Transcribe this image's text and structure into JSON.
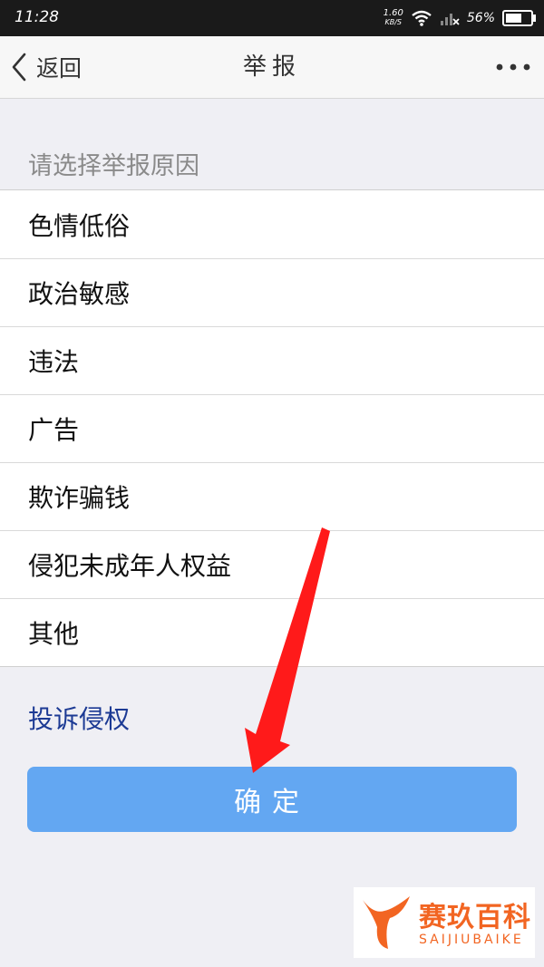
{
  "status_bar": {
    "time": "11:28",
    "net_speed": "1.60",
    "net_unit": "KB/S",
    "battery": "56%"
  },
  "nav": {
    "back_label": "返回",
    "title": "举报",
    "more_icon": "more-dots-icon"
  },
  "section_title": "请选择举报原因",
  "reasons": [
    "色情低俗",
    "政治敏感",
    "违法",
    "广告",
    "欺诈骗钱",
    "侵犯未成年人权益",
    "其他"
  ],
  "complaint_link": "投诉侵权",
  "confirm_label": "确定",
  "watermark": {
    "name": "赛玖百科",
    "sub": "SAIJIUBAIKE"
  },
  "colors": {
    "link": "#1c3a94",
    "button": "#63a7f2",
    "arrow": "#ff1a1a",
    "watermark": "#f26522"
  }
}
